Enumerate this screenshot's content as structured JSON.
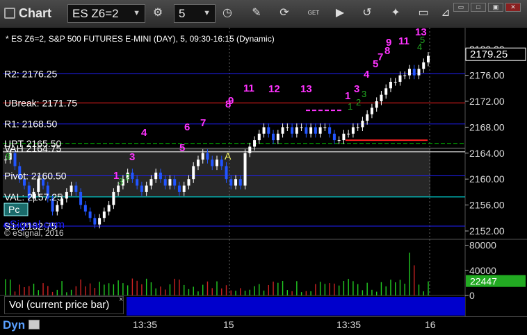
{
  "window": {
    "title": "Chart",
    "accent": "#0000cc"
  },
  "toolbar": {
    "symbol": "ES Z6=2",
    "interval": "5",
    "icons": [
      "settings-icon",
      "clock-icon",
      "pencil-icon",
      "refresh-icon",
      "get-icon",
      "play-icon",
      "link-icon",
      "comment-icon",
      "pin-icon"
    ],
    "get_label": "GET"
  },
  "chart_header": {
    "description": "* ES Z6=2, S&P 500 FUTURES E-MINI (DAY), 5, 09:30-16:15 (Dynamic)"
  },
  "copyright": "© eSignal, 2016",
  "price_axis": {
    "ticks": [
      "2180.00",
      "2176.00",
      "2172.00",
      "2168.00",
      "2164.00",
      "2160.00",
      "2156.00",
      "2152.00"
    ],
    "last_price": "2179.25",
    "last_price_color": "#ffffff"
  },
  "levels": [
    {
      "label": "R2: 2176.25",
      "value": 2176.25,
      "color": "#2020ff"
    },
    {
      "label": "UBreak: 2171.75",
      "value": 2171.75,
      "color": "#ff2020"
    },
    {
      "label": "R1: 2168.50",
      "value": 2168.5,
      "color": "#2020ff"
    },
    {
      "label": "UPT 2165.50",
      "value": 2165.5,
      "color": "#00cc00"
    },
    {
      "label": "VAH 2164.75",
      "value": 2164.75,
      "color": "#888888"
    },
    {
      "label": "Pivot: 2160.50",
      "value": 2160.5,
      "color": "#2020ff"
    },
    {
      "label": "VAL: 2157.25",
      "value": 2157.25,
      "color": "#00cccc"
    },
    {
      "label": "S1: 2152.75",
      "value": 2152.75,
      "color": "#2020ff"
    }
  ],
  "left_badge": "Pc",
  "watermark": "eSignal.com",
  "volume_panel": {
    "label": "Vol (current price bar)",
    "close": "×",
    "axis_ticks": [
      "80000",
      "40000",
      "0"
    ],
    "last_value": "22447",
    "last_value_bg": "#22aa22"
  },
  "time_axis": {
    "ticks": [
      "13:35",
      "15",
      "13:35",
      "16"
    ]
  },
  "status": {
    "dyn": "Dyn"
  },
  "annotations": {
    "magenta_counts": [
      "1",
      "3",
      "4",
      "5",
      "6",
      "7",
      "8",
      "9",
      "11",
      "12",
      "13",
      "1",
      "3",
      "4",
      "5",
      "7",
      "8",
      "9",
      "11",
      "13"
    ],
    "marker_a": "A"
  },
  "chart_data": {
    "type": "candlestick",
    "title": "ES Z6=2, S&P 500 FUTURES E-MINI (DAY), 5",
    "ylim": [
      2150,
      2182
    ],
    "ohlc_close": [
      2163,
      2164,
      2162,
      2160,
      2159,
      2157,
      2158,
      2160,
      2159,
      2157,
      2155,
      2156,
      2157,
      2158,
      2159,
      2158,
      2156,
      2155,
      2154,
      2153,
      2154,
      2155,
      2156,
      2158,
      2159,
      2160,
      2161,
      2160,
      2159,
      2158,
      2159,
      2160,
      2161,
      2160,
      2159,
      2160,
      2159,
      2158,
      2159,
      2160,
      2162,
      2163,
      2164,
      2163,
      2162,
      2163,
      2162,
      2160,
      2159,
      2160,
      2159,
      2164,
      2165,
      2166,
      2167,
      2168,
      2167,
      2166,
      2167,
      2168,
      2168,
      2167,
      2168,
      2168,
      2167,
      2168,
      2167,
      2168,
      2168,
      2167,
      2166,
      2166,
      2167,
      2167,
      2168,
      2168,
      2169,
      2170,
      2171,
      2172,
      2173,
      2174,
      2175,
      2175,
      2176,
      2176,
      2177,
      2176,
      2177,
      2178,
      2179
    ]
  }
}
